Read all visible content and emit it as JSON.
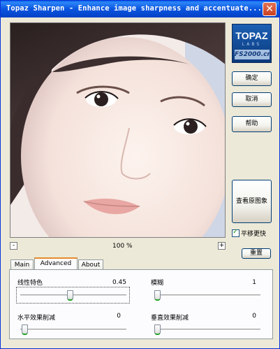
{
  "window": {
    "title": "Topaz Sharpen - Enhance image sharpness and accentuate...",
    "close_label": "✕"
  },
  "logo": {
    "line1": "TOPAZ",
    "line2": "LABS",
    "line3": "FS2000.cn"
  },
  "buttons": {
    "ok": "确定",
    "cancel": "取消",
    "help": "帮助",
    "view_original": "查看原图象",
    "reset": "重置"
  },
  "pan_faster": {
    "label": "平移更快",
    "checked": true
  },
  "zoom": {
    "minus": "-",
    "plus": "+",
    "level": "100 %"
  },
  "tabs": [
    {
      "label": "Main",
      "active": false
    },
    {
      "label": "Advanced",
      "active": true
    },
    {
      "label": "About",
      "active": false
    }
  ],
  "advanced": {
    "linear_feature": {
      "label": "线性特色",
      "value": "0.45",
      "level": 0.45
    },
    "blur": {
      "label": "模糊",
      "value": "1",
      "level": 0.0
    },
    "horizontal_reduce": {
      "label": "水平效果削减",
      "value": "0",
      "level": 0.0
    },
    "vertical_reduce": {
      "label": "垂直效果削减",
      "value": "0",
      "level": 0.0
    }
  }
}
